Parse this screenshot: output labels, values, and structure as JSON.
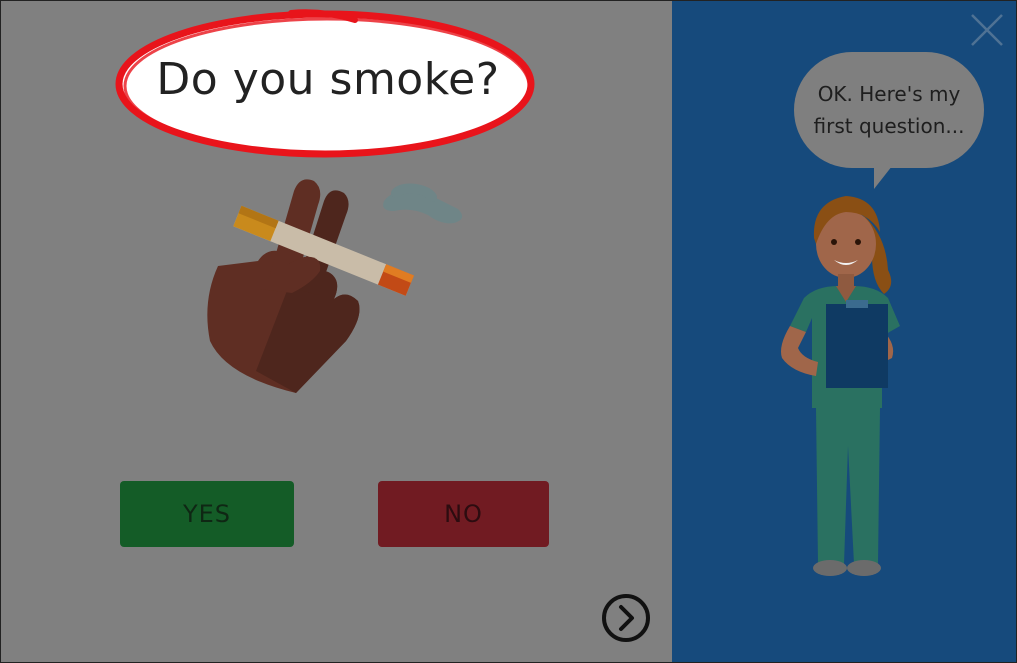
{
  "question": {
    "text": "Do you smoke?"
  },
  "answers": {
    "yes_label": "YES",
    "no_label": "NO"
  },
  "assistant": {
    "speech_line1": "OK. Here's my",
    "speech_line2": "first question..."
  },
  "icons": {
    "close": "close-icon",
    "next": "chevron-right-circle-icon",
    "illustration": "cigarette-hand-icon",
    "character": "nurse-illustration"
  },
  "colors": {
    "left_panel": "#808080",
    "right_panel": "#164a7c",
    "yes": "#145c27",
    "no": "#711b22",
    "highlight": "#e8141b"
  }
}
